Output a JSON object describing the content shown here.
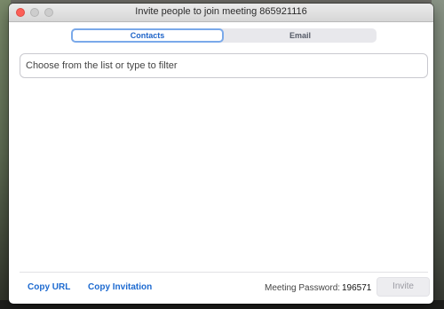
{
  "window": {
    "title": "Invite people to join meeting 865921116"
  },
  "tabs": [
    {
      "label": "Contacts",
      "selected": true
    },
    {
      "label": "Email",
      "selected": false
    }
  ],
  "filter": {
    "value": "",
    "placeholder": "Choose from the list or type to filter"
  },
  "footer": {
    "copy_url_label": "Copy URL",
    "copy_invitation_label": "Copy Invitation",
    "password_label": "Meeting Password:",
    "password_value": "196571",
    "invite_label": "Invite",
    "invite_enabled": false
  },
  "colors": {
    "accent": "#1d6ad0",
    "close_button": "#fc5f57",
    "selected_tab_border": "#7aa9ea"
  }
}
